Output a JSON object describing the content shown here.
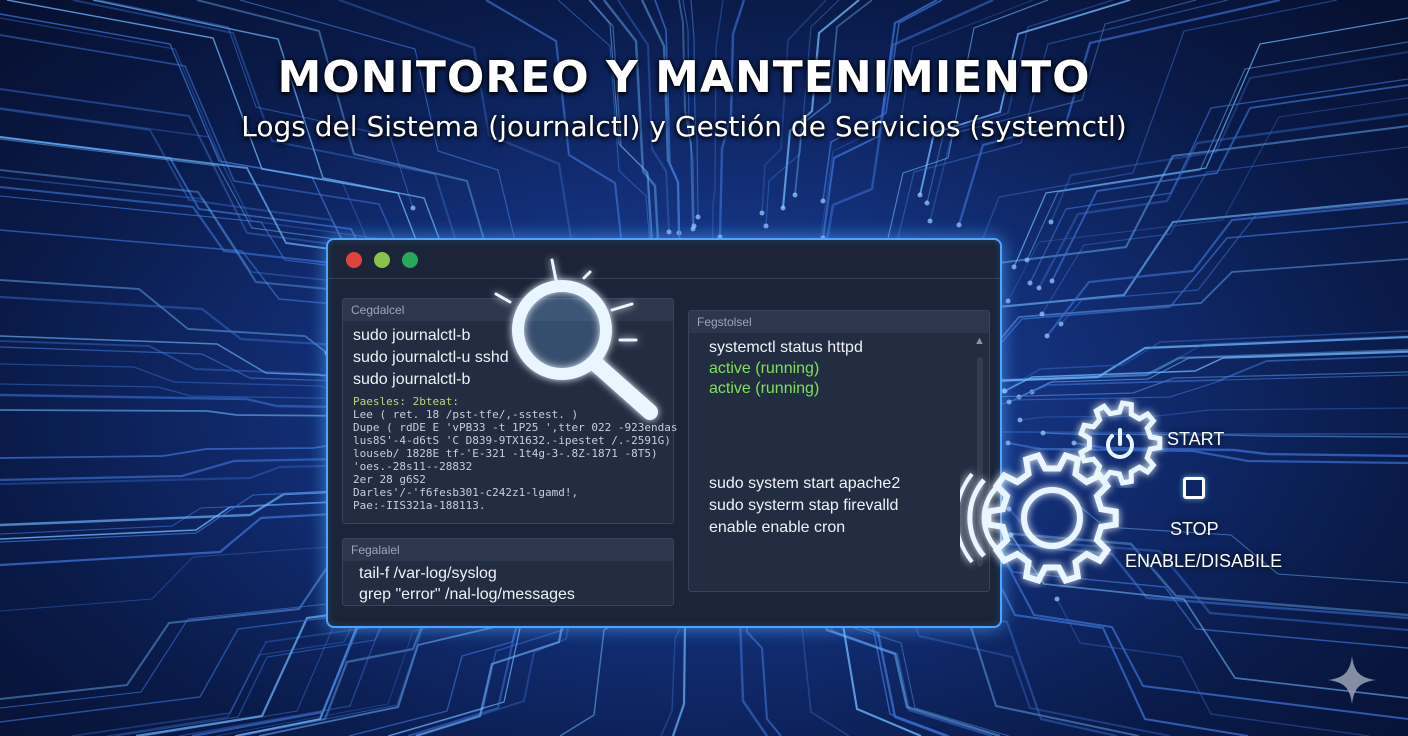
{
  "header": {
    "title": "MONITOREO Y MANTENIMIENTO",
    "subtitle": "Logs del Sistema (journalctl) y Gestión de Servicios (systemctl)"
  },
  "window": {
    "controls": [
      "#e0433e",
      "#8bc34a",
      "#27a85a"
    ],
    "journal_panel": {
      "heading": "Cegdalcel",
      "commands": [
        "sudo journalctl-b",
        "sudo journalctl-u sshd",
        "sudo journalctl-b"
      ],
      "log_lines": [
        "Paesles: 2bteat:",
        "Lee ( ret. 18 /pst-tfe/,-sstest. )",
        "Dupe ( rdDE E 'vPB33 -t 1P25 ',tter 022 -923endas",
        "lus8S'-4-d6tS 'C D839-9TX1632.-ipestet /.-2591G)",
        "louseb/ 1828E tf-'E-321 -1t4g-3-.8Z-1871 -8T5)",
        "'oes.-28s11--28832",
        "2er 28 g6S2",
        "Darles'/-'f6fesb301-c242z1-lgamd!,",
        "Pae:-IIS321a-188113."
      ]
    },
    "logfile_panel": {
      "heading": "Fegalalel",
      "commands": [
        "tail-f /var-log/syslog",
        "grep \"error\" /nal-log/messages"
      ]
    },
    "systemctl_panel": {
      "heading": "Fegstolsel",
      "status_command": "systemctl status httpd",
      "status_lines": [
        "active (running)",
        "active (running)"
      ],
      "commands": [
        "sudo system start apache2",
        "sudo systerm stap firevalld",
        "enable enable cron"
      ]
    }
  },
  "services": {
    "start_label": "START",
    "stop_label": "STOP",
    "enable_label": "ENABLE/DISABILE"
  },
  "colors": {
    "accent_glow": "#4ea4ff",
    "status_green": "#7ee05a"
  },
  "icons": [
    "magnifier-icon",
    "gear-large-icon",
    "gear-small-icon",
    "power-icon",
    "stop-icon",
    "sparkle-icon"
  ]
}
